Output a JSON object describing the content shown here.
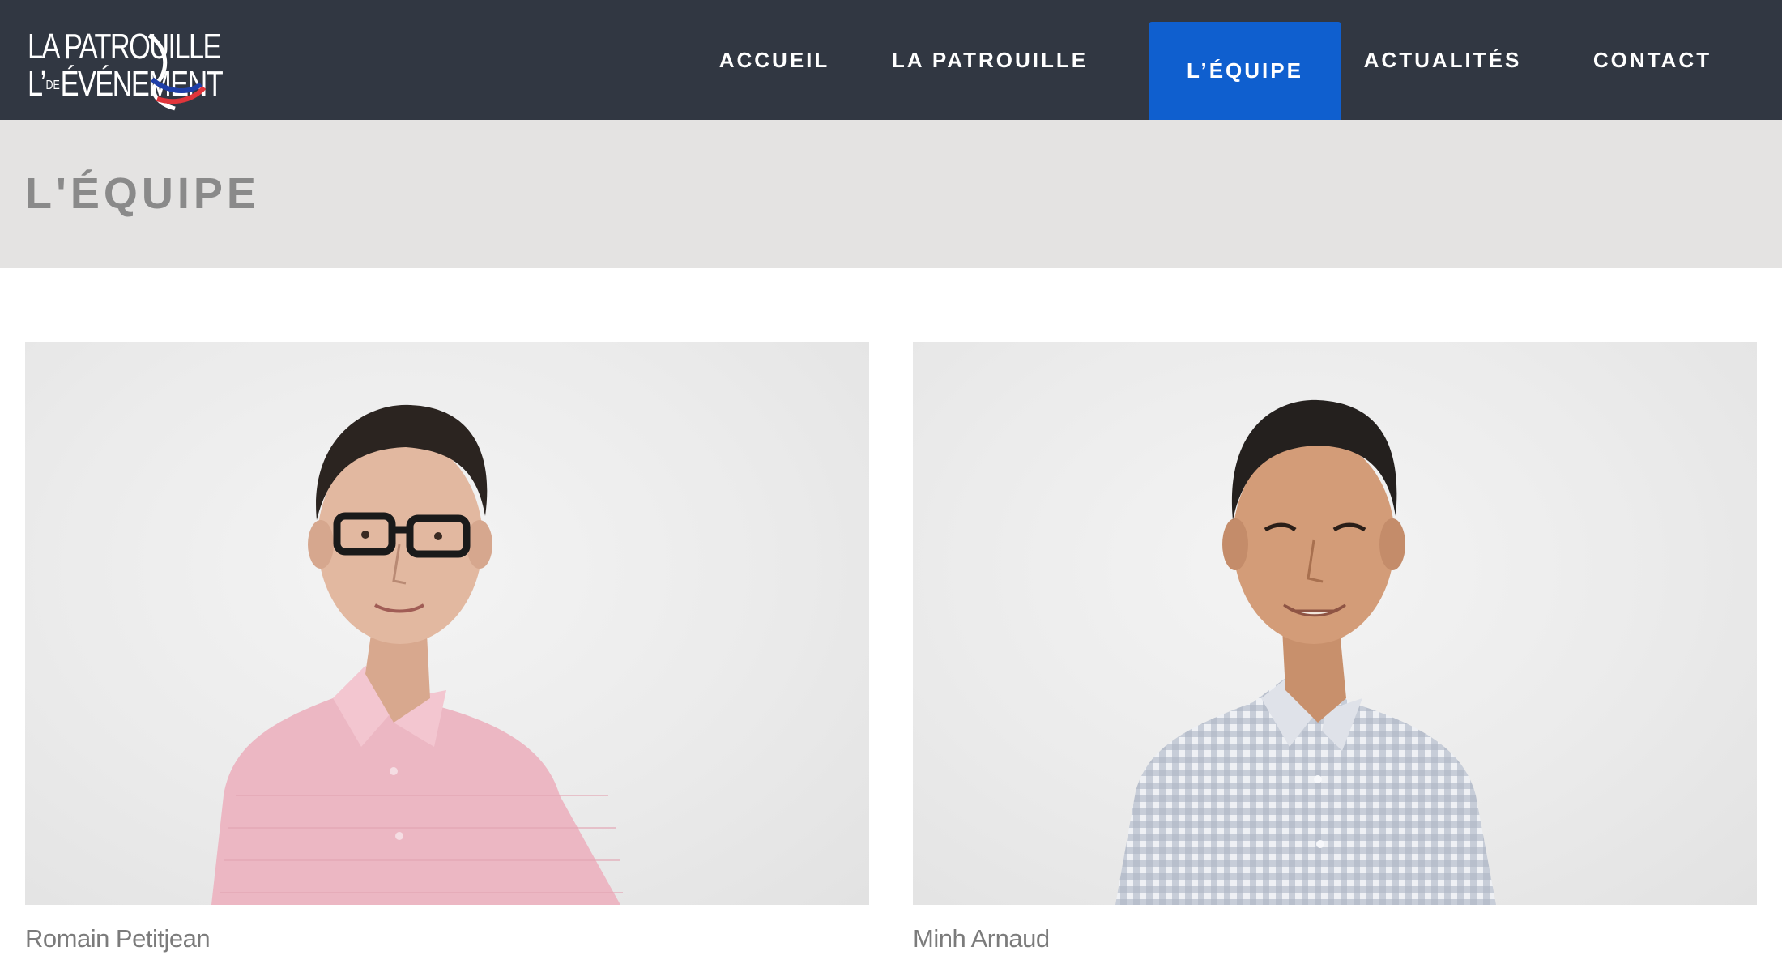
{
  "header": {
    "logo": {
      "line1": "LA PATROUILLE",
      "line2_prefix": "L’",
      "line2_de": "DE",
      "line2_main": "ÉVÉNEMENT"
    },
    "nav": [
      {
        "label": "ACCUEIL",
        "active": false
      },
      {
        "label": "LA PATROUILLE",
        "active": false
      },
      {
        "label": "L’ÉQUIPE",
        "active": true
      },
      {
        "label": "ACTUALITÉS",
        "active": false
      },
      {
        "label": "CONTACT",
        "active": false
      }
    ]
  },
  "page": {
    "title": "L'ÉQUIPE"
  },
  "team": [
    {
      "name": "Romain Petitjean",
      "shirt_color": "#ecb7c3"
    },
    {
      "name": "Minh Arnaud",
      "shirt_color": "#c9ced8"
    }
  ],
  "colors": {
    "header_bg": "#313742",
    "nav_active_bg": "#0f5fcf",
    "title_band_bg": "#e4e3e2",
    "title_text": "#8a8a8a",
    "name_text": "#7b7b7b"
  }
}
